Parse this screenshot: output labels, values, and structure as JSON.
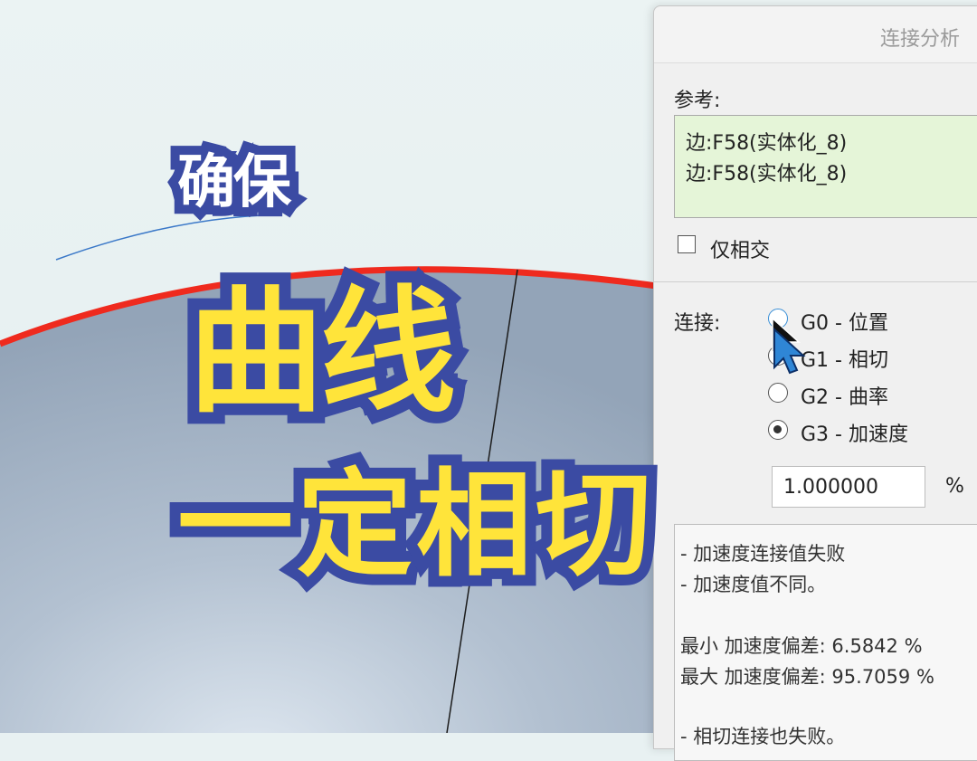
{
  "captions": {
    "top": "确保",
    "middle": "曲线",
    "bottom": "一定相切"
  },
  "dialog": {
    "title": "连接分析",
    "reference_label": "参考:",
    "references": [
      "边:F58(实体化_8)",
      "边:F58(实体化_8)"
    ],
    "intersect_only_label": "仅相交",
    "connection_label": "连接:",
    "options": [
      {
        "label": "G0 - 位置",
        "selected": false
      },
      {
        "label": "G1 - 相切",
        "selected": false
      },
      {
        "label": "G2 - 曲率",
        "selected": false
      },
      {
        "label": "G3 - 加速度",
        "selected": true
      }
    ],
    "tolerance_value": "1.000000",
    "tolerance_unit": "%",
    "results": [
      "- 加速度连接值失败",
      "- 加速度值不同。",
      "",
      "最小 加速度偏差: 6.5842 %",
      "最大 加速度偏差: 95.7059 %",
      "",
      "- 相切连接也失败。"
    ]
  },
  "colors": {
    "edge_highlight": "#ef2a1e",
    "caption_outline": "#3b4ba3",
    "caption_fill": "#ffe43a",
    "reference_bg": "#e5f5d8"
  }
}
